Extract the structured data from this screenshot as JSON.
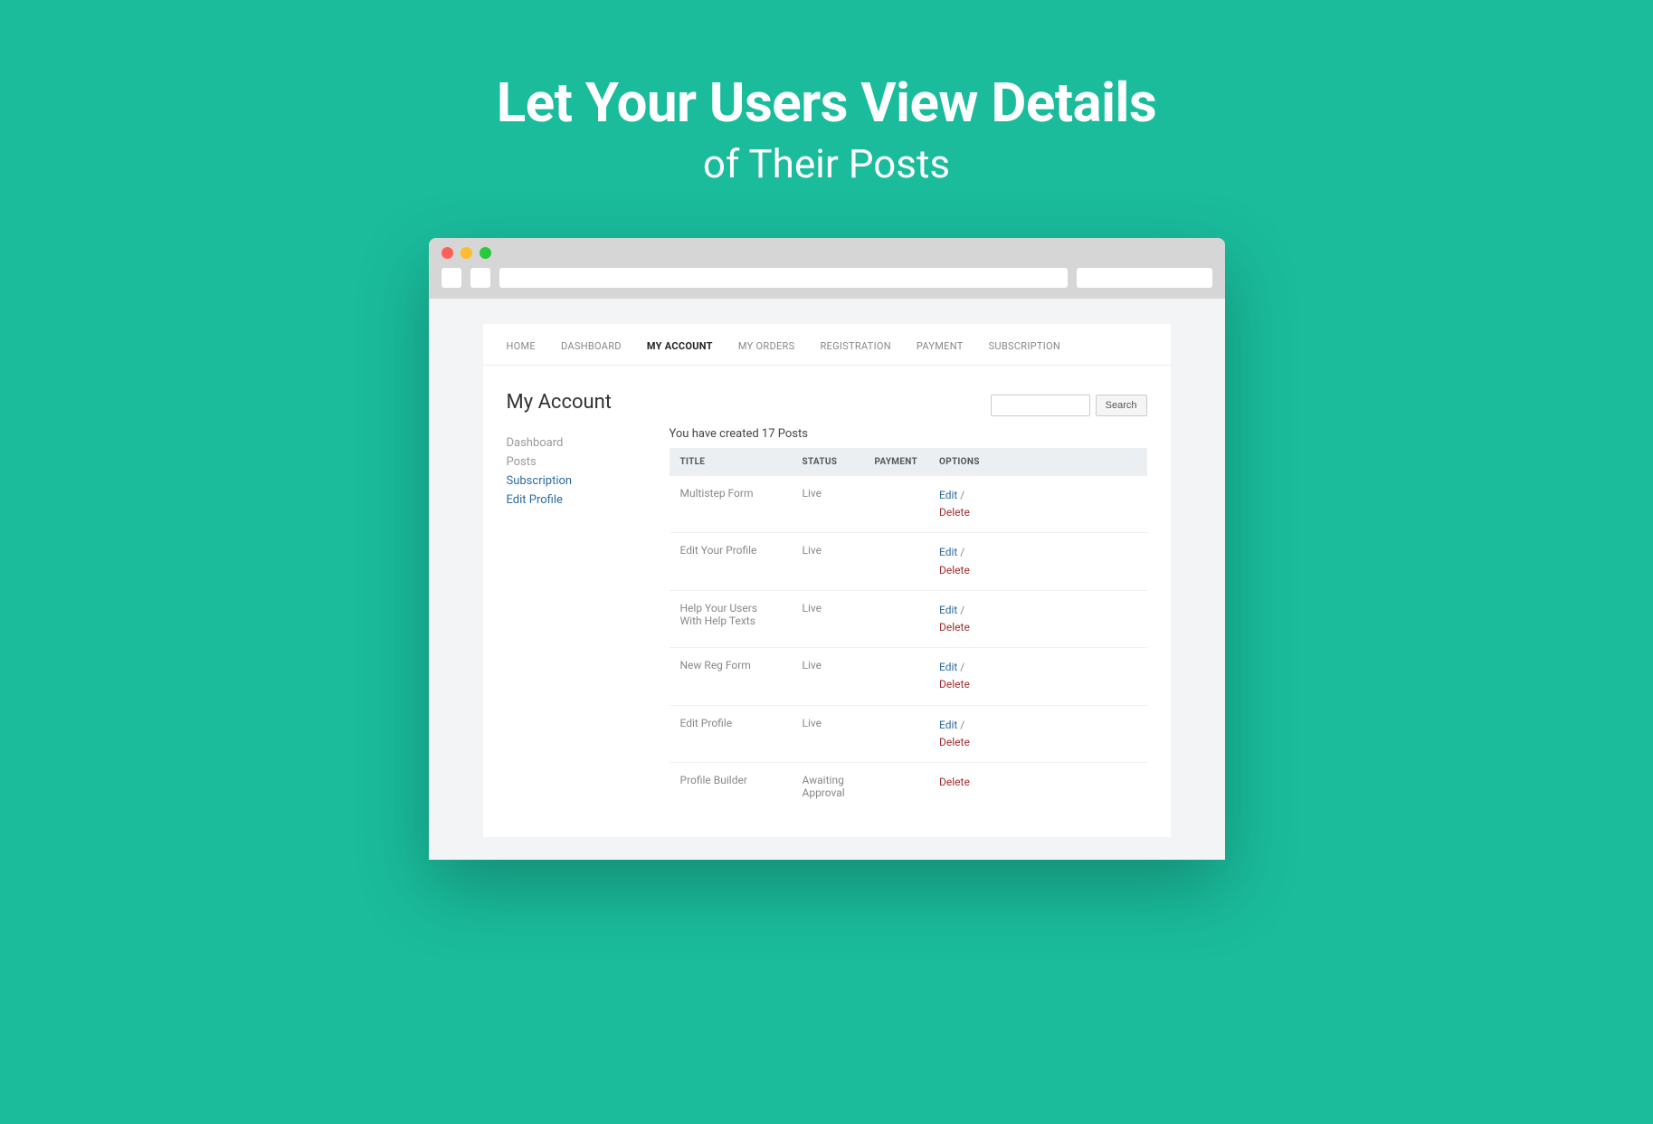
{
  "hero": {
    "title_bold": "Let Your Users View Details",
    "title_light": "of Their Posts"
  },
  "nav": {
    "items": [
      {
        "label": "HOME",
        "active": false
      },
      {
        "label": "DASHBOARD",
        "active": false
      },
      {
        "label": "MY ACCOUNT",
        "active": true
      },
      {
        "label": "MY ORDERS",
        "active": false
      },
      {
        "label": "REGISTRATION",
        "active": false
      },
      {
        "label": "PAYMENT",
        "active": false
      },
      {
        "label": "SUBSCRIPTION",
        "active": false
      }
    ]
  },
  "page_title": "My Account",
  "side_nav": [
    {
      "label": "Dashboard",
      "link": false
    },
    {
      "label": "Posts",
      "link": false
    },
    {
      "label": "Subscription",
      "link": true
    },
    {
      "label": "Edit Profile",
      "link": true
    }
  ],
  "posts_heading": "You have created 17 Posts",
  "table": {
    "headers": {
      "title": "TITLE",
      "status": "STATUS",
      "payment": "PAYMENT",
      "options": "OPTIONS"
    },
    "rows": [
      {
        "title": "Multistep Form",
        "status": "Live",
        "status_class": "live",
        "payment": "",
        "edit": "Edit",
        "delete": "Delete"
      },
      {
        "title": "Edit Your Profile",
        "status": "Live",
        "status_class": "live",
        "payment": "",
        "edit": "Edit",
        "delete": "Delete"
      },
      {
        "title": "Help Your Users With Help Texts",
        "status": "Live",
        "status_class": "live",
        "payment": "",
        "edit": "Edit",
        "delete": "Delete"
      },
      {
        "title": "New Reg Form",
        "status": "Live",
        "status_class": "live",
        "payment": "",
        "edit": "Edit",
        "delete": "Delete"
      },
      {
        "title": "Edit Profile",
        "status": "Live",
        "status_class": "live",
        "payment": "",
        "edit": "Edit",
        "delete": "Delete"
      },
      {
        "title": "Profile Builder",
        "status": "Awaiting Approval",
        "status_class": "awaiting",
        "payment": "",
        "edit": "",
        "delete": "Delete"
      }
    ]
  },
  "search": {
    "button": "Search"
  },
  "option_separator": " / "
}
